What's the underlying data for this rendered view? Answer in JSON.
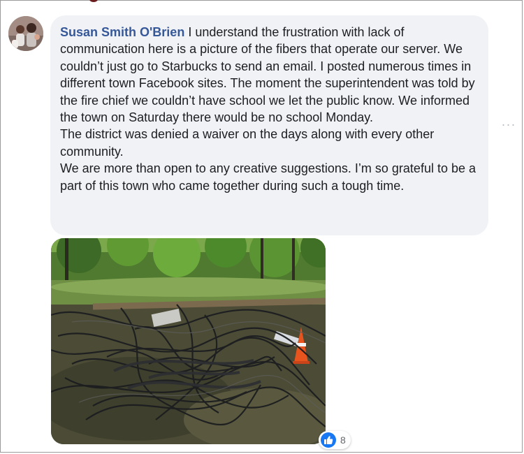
{
  "comment": {
    "author": "Susan Smith O'Brien",
    "text": " I understand the frustration with lack of communication here is a picture of the fibers that operate our server. We couldn’t just go to Starbucks to send an email. I posted numerous times in different town Facebook sites. The moment the superintendent was told by the fire chief we couldn’t have school we let the public know. We informed the town on Saturday there would be no school Monday.\nThe district was denied a waiver on the days along with every other community.\nWe are more than open to any creative suggestions. I’m so grateful to be a part of this town who came together during such a tough time.",
    "reaction_count": "8",
    "reaction_icon": "thumbs-up-icon",
    "more_options_glyph": "···"
  },
  "colors": {
    "author": "#365899",
    "bubble": "#f0f2f5",
    "like": "#1877f2"
  }
}
